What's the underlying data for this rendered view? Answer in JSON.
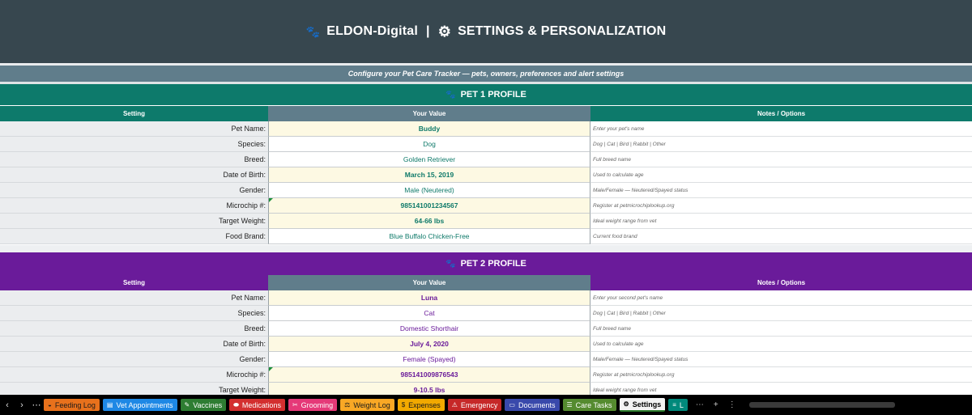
{
  "header": {
    "brand": "ELDON-Digital",
    "separator": "|",
    "title": "SETTINGS & PERSONALIZATION",
    "subtitle": "Configure your Pet Care Tracker — pets, owners, preferences and alert settings"
  },
  "columns": {
    "setting": "Setting",
    "value": "Your Value",
    "notes": "Notes / Options"
  },
  "pet1": {
    "section_title": "PET 1 PROFILE",
    "color": "#0d7a6b",
    "rows": [
      {
        "label": "Pet Name:",
        "value": "Buddy",
        "note": "Enter your pet's name"
      },
      {
        "label": "Species:",
        "value": "Dog",
        "note": "Dog | Cat | Bird | Rabbit | Other"
      },
      {
        "label": "Breed:",
        "value": "Golden Retriever",
        "note": "Full breed name"
      },
      {
        "label": "Date of Birth:",
        "value": "March 15, 2019",
        "note": "Used to calculate age"
      },
      {
        "label": "Gender:",
        "value": "Male (Neutered)",
        "note": "Male/Female — Neutered/Spayed status"
      },
      {
        "label": "Microchip #:",
        "value": "985141001234567",
        "note": "Register at petmicrochiplookup.org"
      },
      {
        "label": "Target Weight:",
        "value": "64-66 lbs",
        "note": "Ideal weight range from vet"
      },
      {
        "label": "Food Brand:",
        "value": "Blue Buffalo Chicken-Free",
        "note": "Current food brand"
      }
    ]
  },
  "pet2": {
    "section_title": "PET 2 PROFILE",
    "color": "#6a1b9a",
    "rows": [
      {
        "label": "Pet Name:",
        "value": "Luna",
        "note": "Enter your second pet's name"
      },
      {
        "label": "Species:",
        "value": "Cat",
        "note": "Dog | Cat | Bird | Rabbit | Other"
      },
      {
        "label": "Breed:",
        "value": "Domestic Shorthair",
        "note": "Full breed name"
      },
      {
        "label": "Date of Birth:",
        "value": "July 4, 2020",
        "note": "Used to calculate age"
      },
      {
        "label": "Gender:",
        "value": "Female (Spayed)",
        "note": "Male/Female — Neutered/Spayed status"
      },
      {
        "label": "Microchip #:",
        "value": "985141009876543",
        "note": "Register at petmicrochiplookup.org"
      },
      {
        "label": "Target Weight:",
        "value": "9-10.5 lbs",
        "note": "Ideal weight range from vet"
      }
    ]
  },
  "tabs": [
    {
      "label": "Feeding Log",
      "icon": "bowl-icon",
      "color": "#e8711c"
    },
    {
      "label": "Vet Appointments",
      "icon": "clipboard-icon",
      "color": "#1e88e5"
    },
    {
      "label": "Vaccines",
      "icon": "syringe-icon",
      "color": "#2e7d32"
    },
    {
      "label": "Medications",
      "icon": "pill-icon",
      "color": "#d32f2f"
    },
    {
      "label": "Grooming",
      "icon": "scissors-icon",
      "color": "#e53978"
    },
    {
      "label": "Weight Log",
      "icon": "scale-icon",
      "color": "#f9a825"
    },
    {
      "label": "Expenses",
      "icon": "money-icon",
      "color": "#f2a900"
    },
    {
      "label": "Emergency",
      "icon": "alert-icon",
      "color": "#c62828"
    },
    {
      "label": "Documents",
      "icon": "folder-icon",
      "color": "#3949ab"
    },
    {
      "label": "Care Tasks",
      "icon": "checklist-icon",
      "color": "#558b2f"
    },
    {
      "label": "Settings",
      "icon": "gear-icon",
      "color": "#f3f3f3",
      "active": true
    },
    {
      "label": "L",
      "icon": "list-icon",
      "color": "#00897b"
    }
  ]
}
